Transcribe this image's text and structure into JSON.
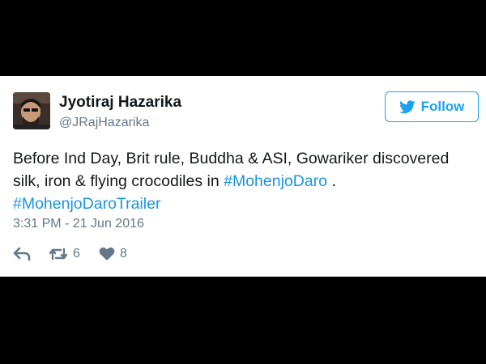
{
  "user": {
    "display_name": "Jyotiraj Hazarika",
    "handle": "@JRajHazarika",
    "avatar_icon": "profile-photo"
  },
  "follow_button": {
    "label": "Follow",
    "icon": "bird-icon",
    "color": "#1da1f2"
  },
  "tweet": {
    "text_segment_1": "Before Ind Day, Brit rule, Buddha & ASI, Gowariker discovered silk, iron & flying crocodiles in ",
    "hashtag_1": "#MohenjoDaro",
    "text_segment_2": " .",
    "hashtag_2": "#MohenjoDaroTrailer",
    "timestamp": "3:31 PM - 21 Jun 2016",
    "link_color": "#1b95e0"
  },
  "actions": {
    "reply_icon": "reply-icon",
    "retweet_icon": "retweet-icon",
    "retweet_count": "6",
    "like_icon": "heart-icon",
    "like_count": "8"
  }
}
